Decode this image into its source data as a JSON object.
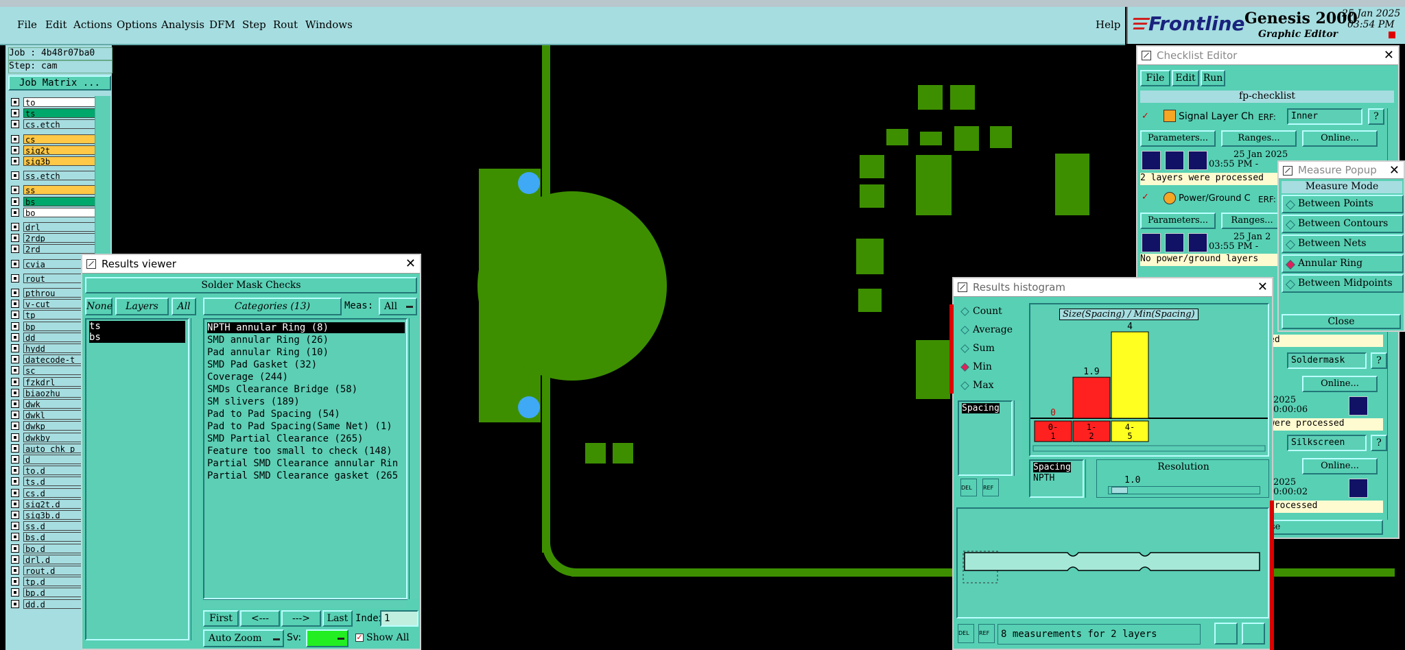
{
  "menubar": {
    "items": [
      "File",
      "Edit",
      "Actions",
      "Options",
      "Analysis",
      "DFM",
      "Step",
      "Rout",
      "Windows"
    ],
    "help": "Help"
  },
  "logo": {
    "brand": "Frontline",
    "product": "Genesis 2000",
    "subtitle": "Graphic Editor",
    "date": "25 Jan 2025",
    "time": "03:54 PM"
  },
  "left_panel": {
    "job": "Job : 4b48r07ba0",
    "step": "Step: cam",
    "job_matrix": "Job Matrix ...",
    "layers": [
      {
        "name": "to",
        "color": "#ffffff"
      },
      {
        "name": "ts",
        "color": "#00a86b"
      },
      {
        "name": "cs.etch",
        "color": "#a6dde0"
      },
      {
        "name": "cs",
        "color": "#ffc846"
      },
      {
        "name": "sig2t",
        "color": "#ffc846"
      },
      {
        "name": "sig3b",
        "color": "#ffc846"
      },
      {
        "name": "ss.etch",
        "color": "#a6dde0"
      },
      {
        "name": "ss",
        "color": "#ffc846"
      },
      {
        "name": "bs",
        "color": "#00a86b"
      },
      {
        "name": "bo",
        "color": "#ffffff"
      },
      {
        "name": "drl",
        "color": "#a6dde0"
      },
      {
        "name": "2rdp",
        "color": "#a6dde0"
      },
      {
        "name": "2rd",
        "color": "#a6dde0"
      },
      {
        "name": "cvia",
        "color": "#a6dde0"
      },
      {
        "name": "rout",
        "color": "#a6dde0"
      },
      {
        "name": "pthrou",
        "color": "#a6dde0"
      },
      {
        "name": "v-cut",
        "color": "#a6dde0"
      },
      {
        "name": "tp",
        "color": "#a6dde0"
      },
      {
        "name": "bp",
        "color": "#a6dde0"
      },
      {
        "name": "dd",
        "color": "#a6dde0"
      },
      {
        "name": "hydd",
        "color": "#a6dde0"
      },
      {
        "name": "datecode-t",
        "color": "#a6dde0"
      },
      {
        "name": "sc",
        "color": "#a6dde0"
      },
      {
        "name": "fzkdrl",
        "color": "#a6dde0"
      },
      {
        "name": "biaozhu",
        "color": "#a6dde0"
      },
      {
        "name": "dwk",
        "color": "#a6dde0"
      },
      {
        "name": "dwkl",
        "color": "#a6dde0"
      },
      {
        "name": "dwkp",
        "color": "#a6dde0"
      },
      {
        "name": "dwkby",
        "color": "#a6dde0"
      },
      {
        "name": "auto_chk_p",
        "color": "#a6dde0"
      },
      {
        "name": "d",
        "color": "#a6dde0"
      },
      {
        "name": "to.d",
        "color": "#a6dde0"
      },
      {
        "name": "ts.d",
        "color": "#a6dde0"
      },
      {
        "name": "cs.d",
        "color": "#a6dde0"
      },
      {
        "name": "sig2t.d",
        "color": "#a6dde0"
      },
      {
        "name": "sig3b.d",
        "color": "#a6dde0"
      },
      {
        "name": "ss.d",
        "color": "#a6dde0"
      },
      {
        "name": "bs.d",
        "color": "#a6dde0"
      },
      {
        "name": "bo.d",
        "color": "#a6dde0"
      },
      {
        "name": "drl.d",
        "color": "#a6dde0"
      },
      {
        "name": "rout.d",
        "color": "#a6dde0"
      },
      {
        "name": "tp.d",
        "color": "#a6dde0"
      },
      {
        "name": "bp.d",
        "color": "#a6dde0"
      },
      {
        "name": "dd.d",
        "color": "#a6dde0"
      }
    ]
  },
  "results_viewer": {
    "title": "Results viewer",
    "header": "Solder Mask Checks",
    "none": "None",
    "layers": "Layers",
    "all": "All",
    "categories": "Categories (13)",
    "meas_label": "Meas:",
    "meas_value": "All",
    "layer_list": [
      "ts",
      "bs"
    ],
    "category_list": [
      "NPTH annular Ring (8)",
      "SMD annular Ring (26)",
      "Pad annular Ring (10)",
      "SMD Pad Gasket (32)",
      "Coverage (244)",
      "SMDs Clearance Bridge (58)",
      "SM slivers (189)",
      "Pad to Pad Spacing (54)",
      "Pad to Pad Spacing(Same Net) (1)",
      "SMD Partial Clearance (265)",
      "Feature too small to check (148)",
      "Partial SMD Clearance annular Rin",
      "Partial SMD Clearance gasket (265"
    ],
    "first": "First",
    "prev": "<---",
    "next": "--->",
    "last": "Last",
    "index_label": "Index:",
    "index_value": "1",
    "auto_zoom": "Auto Zoom",
    "sv_label": "Sv:",
    "show_all": "Show All"
  },
  "checklist": {
    "title": "Checklist Editor",
    "menu": [
      "File",
      "Edit",
      "Run"
    ],
    "name": "fp-checklist",
    "item1_name": "Signal Layer Ch",
    "erf": "ERF:",
    "item1_erf": "Inner",
    "parameters": "Parameters...",
    "ranges": "Ranges...",
    "online": "Online...",
    "item1_date": "25 Jan 2025",
    "item1_time": "03:55 PM - ",
    "item1_status": "2 layers were processed",
    "item2_name": "Power/Ground C",
    "item2_date": "25 Jan 2",
    "item2_time": "03:55 PM - ",
    "item2_status": "No power/ground layers",
    "status_ed": "ed",
    "erf_soldermask": "Soldermask",
    "date_2025": "2025",
    "dur1": "0:00:06",
    "status_were": "were processed",
    "erf_silkscreen": "Silkscreen",
    "dur2": "0:00:02",
    "status_proc": "processed",
    "close_se": "se"
  },
  "measure": {
    "title": "Measure Popup",
    "mode": "Measure Mode",
    "options": [
      "Between Points",
      "Between Contours",
      "Between Nets",
      "Annular Ring",
      "Between Midpoints"
    ],
    "selected": 3,
    "close": "Close"
  },
  "histogram": {
    "title": "Results histogram",
    "stats": [
      "Count",
      "Average",
      "Sum",
      "Min",
      "Max"
    ],
    "selected_stat": 3,
    "list_item": "Spacing",
    "chart_title": "Size(Spacing) / Min(Spacing)",
    "spacing_label": "Spacing",
    "npth_label": "NPTH",
    "resolution_label": "Resolution",
    "resolution_value": "1.0",
    "del": "DEL",
    "ref": "REF",
    "status": "8 measurements for 2 layers"
  },
  "chart_data": {
    "type": "bar",
    "title": "Size(Spacing) / Min(Spacing)",
    "categories": [
      "0-1",
      "1-2",
      "4-5"
    ],
    "values": [
      0,
      1.9,
      4
    ],
    "colors": [
      "#ff2020",
      "#ff2020",
      "#ffff20"
    ],
    "ylim": [
      0,
      4
    ]
  }
}
